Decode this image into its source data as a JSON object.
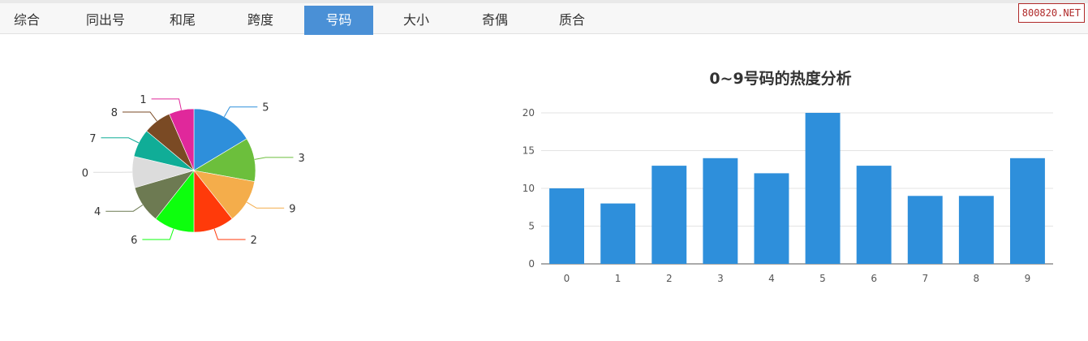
{
  "tabs": [
    {
      "label": "综合",
      "active": false
    },
    {
      "label": "同出号",
      "active": false
    },
    {
      "label": "和尾",
      "active": false
    },
    {
      "label": "跨度",
      "active": false
    },
    {
      "label": "号码",
      "active": true
    },
    {
      "label": "大小",
      "active": false
    },
    {
      "label": "奇偶",
      "active": false
    },
    {
      "label": "质合",
      "active": false
    }
  ],
  "watermark": "800820.NET",
  "colors": {
    "accent": "#4a90d6",
    "bar": "#2e8fdb"
  },
  "chart_data": [
    {
      "type": "pie",
      "title": "",
      "slices": [
        {
          "label": "5",
          "value": 20,
          "color": "#2e8fdb"
        },
        {
          "label": "3",
          "value": 14,
          "color": "#6cbf3c"
        },
        {
          "label": "9",
          "value": 14,
          "color": "#f4ad4b"
        },
        {
          "label": "2",
          "value": 13,
          "color": "#ff3a0a"
        },
        {
          "label": "6",
          "value": 13,
          "color": "#0dff0d"
        },
        {
          "label": "4",
          "value": 12,
          "color": "#6d7a52"
        },
        {
          "label": "0",
          "value": 10,
          "color": "#dcdcdc"
        },
        {
          "label": "7",
          "value": 9,
          "color": "#10ad97"
        },
        {
          "label": "8",
          "value": 9,
          "color": "#7a4a24"
        },
        {
          "label": "1",
          "value": 8,
          "color": "#e0289b"
        }
      ]
    },
    {
      "type": "bar",
      "title": "0~9号码的热度分析",
      "categories": [
        "0",
        "1",
        "2",
        "3",
        "4",
        "5",
        "6",
        "7",
        "8",
        "9"
      ],
      "values": [
        10,
        8,
        13,
        14,
        12,
        20,
        13,
        9,
        9,
        14
      ],
      "yticks": [
        0,
        5,
        10,
        15,
        20
      ],
      "ylim": [
        0,
        20
      ],
      "grid": true
    }
  ]
}
